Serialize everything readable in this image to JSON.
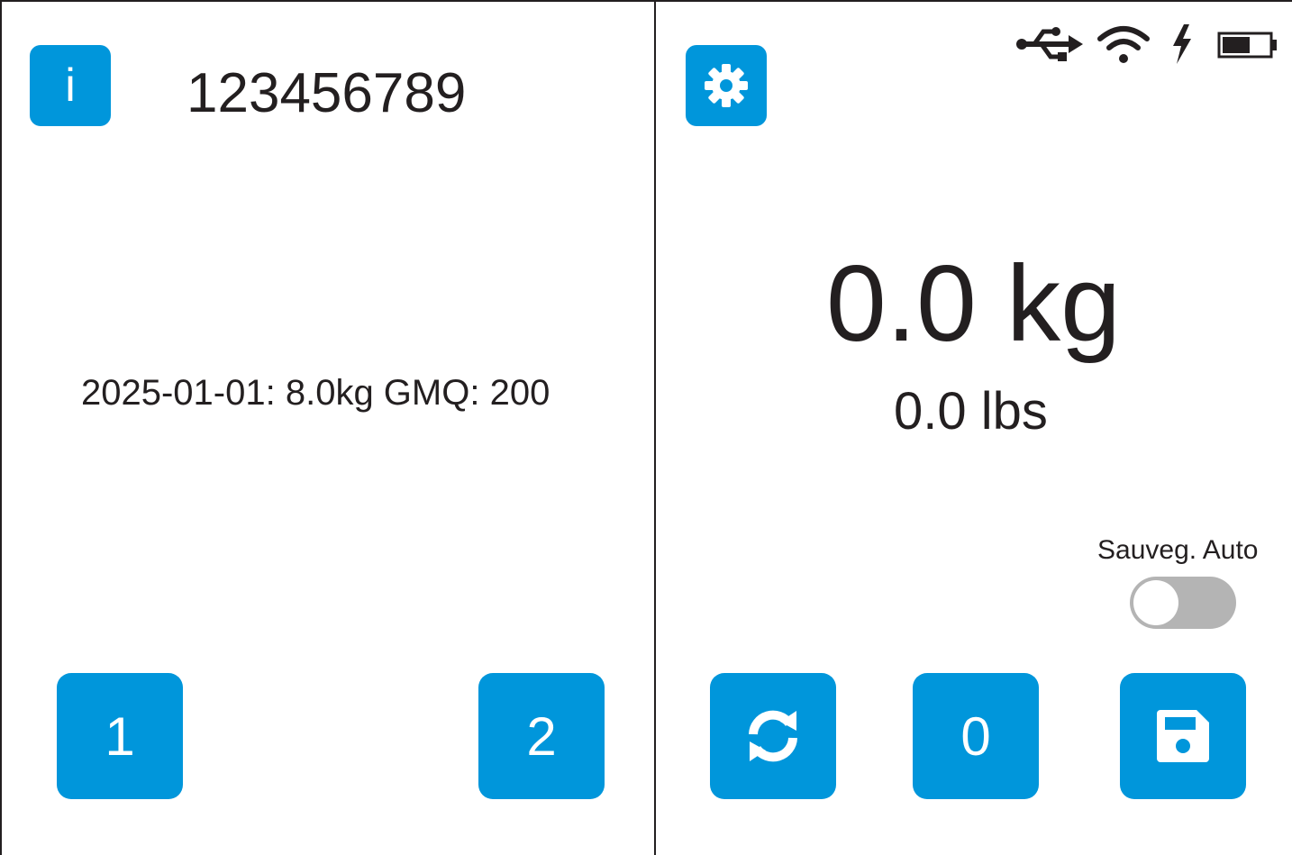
{
  "left_panel": {
    "info_label": "i",
    "device_id": "123456789",
    "last_record": "2025-01-01: 8.0kg GMQ: 200",
    "button_1_label": "1",
    "button_2_label": "2"
  },
  "right_panel": {
    "weight_kg": "0.0 kg",
    "weight_lbs": "0.0 lbs",
    "auto_save": {
      "label": "Sauveg. Auto",
      "enabled": false
    },
    "zero_button_label": "0",
    "battery_level": 0.6
  },
  "icons": {
    "info": "info-icon",
    "settings": "gear-icon",
    "usb": "usb-icon",
    "wifi": "wifi-icon",
    "charging": "bolt-icon",
    "battery": "battery-icon",
    "refresh": "refresh-icon",
    "save": "save-icon"
  },
  "colors": {
    "accent": "#0096db",
    "text": "#231f20",
    "toggle_off": "#b4b4b4"
  }
}
